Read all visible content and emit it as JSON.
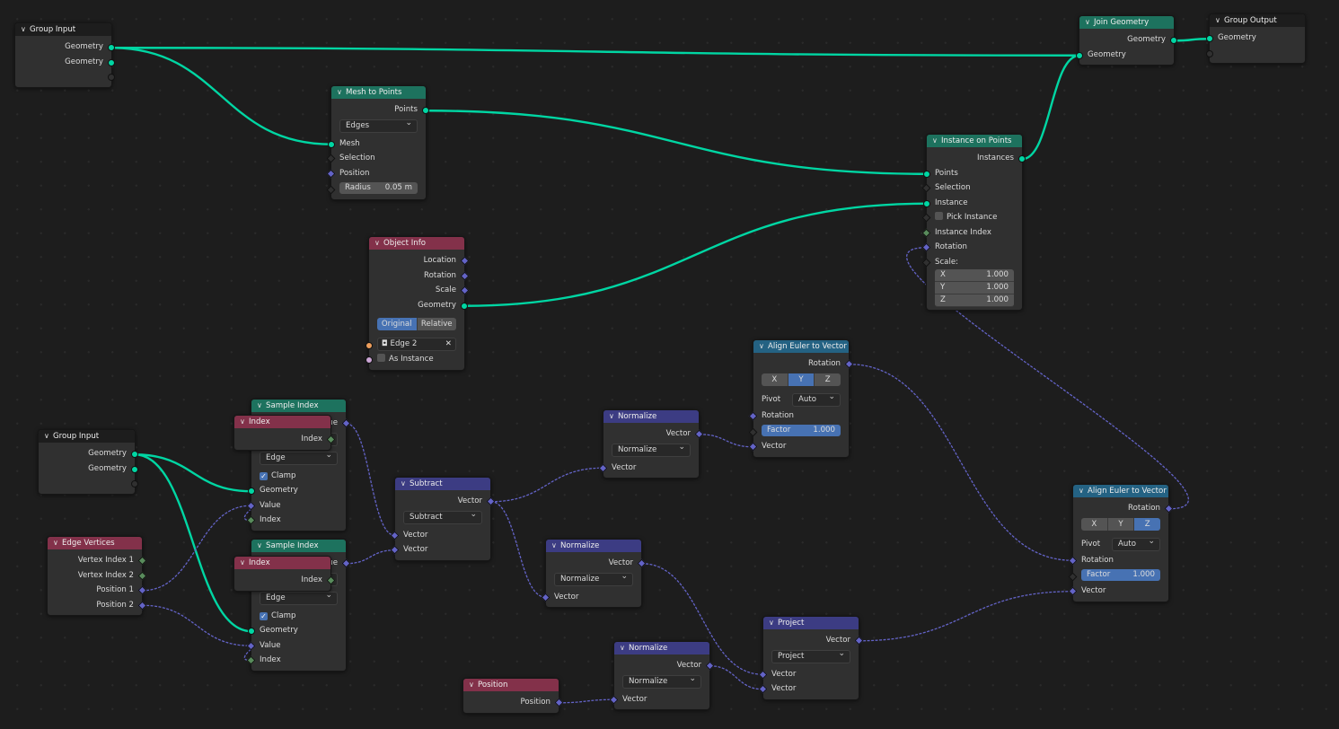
{
  "colors": {
    "background": "#1d1d1d",
    "geometry_header": "#1d725e",
    "input_header": "#83314a",
    "vector_header": "#3c3c83",
    "converter_header": "#246283",
    "group_header": "#1d1d1d",
    "geometry_link": "#00d6a3",
    "field_link": "#6363c7"
  },
  "socket_colors": {
    "geometry": "#00d6a3",
    "vector": "#6363c7",
    "bool": "#cca6d6",
    "int": "#598c5c",
    "float": "#a1a1a1",
    "object": "#ed9e5c",
    "empty": "#6b6b6b"
  },
  "nodes": [
    {
      "id": "group-input-1",
      "title": "Group Input",
      "kind": "group",
      "rows": [
        {
          "t": "out",
          "label": "Geometry",
          "s": "geometry",
          "sh": "circle"
        },
        {
          "t": "out",
          "label": "Geometry",
          "s": "geometry",
          "sh": "circle"
        },
        {
          "t": "out",
          "label": "",
          "s": "empty",
          "sh": "circle hollow"
        }
      ]
    },
    {
      "id": "mesh-to-points",
      "title": "Mesh to Points",
      "kind": "geometry",
      "rows": [
        {
          "t": "out",
          "label": "Points",
          "s": "geometry",
          "sh": "circle"
        },
        {
          "t": "dd",
          "value": "Edges"
        },
        {
          "t": "in",
          "label": "Mesh",
          "s": "geometry",
          "sh": "circle"
        },
        {
          "t": "in",
          "label": "Selection",
          "s": "bool",
          "sh": "diamond hollow"
        },
        {
          "t": "in",
          "label": "Position",
          "s": "vector",
          "sh": "diamond"
        },
        {
          "t": "field",
          "label": "Radius",
          "value": "0.05 m",
          "s": "float",
          "sh": "diamond hollow"
        }
      ]
    },
    {
      "id": "join-geometry",
      "title": "Join Geometry",
      "kind": "geometry",
      "rows": [
        {
          "t": "out",
          "label": "Geometry",
          "s": "geometry",
          "sh": "circle"
        },
        {
          "t": "in",
          "label": "Geometry",
          "s": "geometry",
          "sh": "circle"
        }
      ]
    },
    {
      "id": "group-output",
      "title": "Group Output",
      "kind": "group",
      "rows": [
        {
          "t": "in",
          "label": "Geometry",
          "s": "geometry",
          "sh": "circle"
        },
        {
          "t": "in",
          "label": "",
          "s": "empty",
          "sh": "circle hollow"
        }
      ]
    },
    {
      "id": "instance-on-points",
      "title": "Instance on Points",
      "kind": "geometry",
      "rows": [
        {
          "t": "out",
          "label": "Instances",
          "s": "geometry",
          "sh": "circle"
        },
        {
          "t": "in",
          "label": "Points",
          "s": "geometry",
          "sh": "circle"
        },
        {
          "t": "in",
          "label": "Selection",
          "s": "bool",
          "sh": "diamond hollow"
        },
        {
          "t": "in",
          "label": "Instance",
          "s": "geometry",
          "sh": "circle"
        },
        {
          "t": "check",
          "label": "Pick Instance",
          "checked": false,
          "s": "bool",
          "sh": "diamond hollow"
        },
        {
          "t": "in",
          "label": "Instance Index",
          "s": "int",
          "sh": "diamond"
        },
        {
          "t": "in",
          "label": "Rotation",
          "s": "vector",
          "sh": "diamond"
        },
        {
          "t": "in",
          "label": "Scale:",
          "s": "vector",
          "sh": "diamond hollow"
        },
        {
          "t": "xyz",
          "values": [
            [
              "X",
              "1.000"
            ],
            [
              "Y",
              "1.000"
            ],
            [
              "Z",
              "1.000"
            ]
          ]
        }
      ]
    },
    {
      "id": "object-info",
      "title": "Object Info",
      "kind": "input",
      "rows": [
        {
          "t": "out",
          "label": "Location",
          "s": "vector",
          "sh": "diamond"
        },
        {
          "t": "out",
          "label": "Rotation",
          "s": "vector",
          "sh": "diamond"
        },
        {
          "t": "out",
          "label": "Scale",
          "s": "vector",
          "sh": "diamond"
        },
        {
          "t": "out",
          "label": "Geometry",
          "s": "geometry",
          "sh": "circle"
        },
        {
          "t": "gap"
        },
        {
          "t": "seg",
          "options": [
            "Original",
            "Relative"
          ],
          "active": 0
        },
        {
          "t": "obj",
          "value": "Edge 2",
          "s": "object",
          "sh": "circle"
        },
        {
          "t": "check",
          "label": "As Instance",
          "checked": false,
          "s": "bool",
          "sh": "circle"
        }
      ]
    },
    {
      "id": "align-euler-1",
      "title": "Align Euler to Vector",
      "kind": "converter",
      "rows": [
        {
          "t": "out",
          "label": "Rotation",
          "s": "vector",
          "sh": "diamond"
        },
        {
          "t": "seg",
          "options": [
            "X",
            "Y",
            "Z"
          ],
          "active": 1
        },
        {
          "t": "pivot",
          "label": "Pivot",
          "value": "Auto"
        },
        {
          "t": "in",
          "label": "Rotation",
          "s": "vector",
          "sh": "diamond"
        },
        {
          "t": "field",
          "label": "Factor",
          "value": "1.000",
          "blue": true,
          "s": "float",
          "sh": "diamond hollow"
        },
        {
          "t": "in",
          "label": "Vector",
          "s": "vector",
          "sh": "diamond"
        }
      ]
    },
    {
      "id": "normalize-1",
      "title": "Normalize",
      "kind": "vector",
      "rows": [
        {
          "t": "out",
          "label": "Vector",
          "s": "vector",
          "sh": "diamond"
        },
        {
          "t": "dd",
          "value": "Normalize"
        },
        {
          "t": "in",
          "label": "Vector",
          "s": "vector",
          "sh": "diamond"
        }
      ]
    },
    {
      "id": "subtract",
      "title": "Subtract",
      "kind": "vector",
      "rows": [
        {
          "t": "out",
          "label": "Vector",
          "s": "vector",
          "sh": "diamond"
        },
        {
          "t": "dd",
          "value": "Subtract"
        },
        {
          "t": "in",
          "label": "Vector",
          "s": "vector",
          "sh": "diamond"
        },
        {
          "t": "in",
          "label": "Vector",
          "s": "vector",
          "sh": "diamond"
        }
      ]
    },
    {
      "id": "sample-index-1",
      "title": "Sample Index",
      "kind": "geometry",
      "rows": [
        {
          "t": "out",
          "label": "Value",
          "s": "vector",
          "sh": "diamond"
        },
        {
          "t": "dd",
          "value": ""
        },
        {
          "t": "dd",
          "value": "Edge"
        },
        {
          "t": "check",
          "label": "Clamp",
          "checked": true
        },
        {
          "t": "in",
          "label": "Geometry",
          "s": "geometry",
          "sh": "circle"
        },
        {
          "t": "in",
          "label": "Value",
          "s": "vector",
          "sh": "diamond"
        },
        {
          "t": "in",
          "label": "Index",
          "s": "int",
          "sh": "diamond"
        }
      ]
    },
    {
      "id": "index-1",
      "title": "Index",
      "kind": "input",
      "rows": [
        {
          "t": "out",
          "label": "Index",
          "s": "int",
          "sh": "diamond"
        }
      ]
    },
    {
      "id": "sample-index-2",
      "title": "Sample Index",
      "kind": "geometry",
      "rows": [
        {
          "t": "out",
          "label": "Value",
          "s": "vector",
          "sh": "diamond"
        },
        {
          "t": "dd",
          "value": ""
        },
        {
          "t": "dd",
          "value": "Edge"
        },
        {
          "t": "check",
          "label": "Clamp",
          "checked": true
        },
        {
          "t": "in",
          "label": "Geometry",
          "s": "geometry",
          "sh": "circle"
        },
        {
          "t": "in",
          "label": "Value",
          "s": "vector",
          "sh": "diamond"
        },
        {
          "t": "in",
          "label": "Index",
          "s": "int",
          "sh": "diamond"
        }
      ]
    },
    {
      "id": "index-2",
      "title": "Index",
      "kind": "input",
      "rows": [
        {
          "t": "out",
          "label": "Index",
          "s": "int",
          "sh": "diamond"
        }
      ]
    },
    {
      "id": "group-input-2",
      "title": "Group Input",
      "kind": "group",
      "rows": [
        {
          "t": "out",
          "label": "Geometry",
          "s": "geometry",
          "sh": "circle"
        },
        {
          "t": "out",
          "label": "Geometry",
          "s": "geometry",
          "sh": "circle"
        },
        {
          "t": "out",
          "label": "",
          "s": "empty",
          "sh": "circle hollow"
        }
      ]
    },
    {
      "id": "edge-vertices",
      "title": "Edge Vertices",
      "kind": "input",
      "rows": [
        {
          "t": "out",
          "label": "Vertex Index 1",
          "s": "int",
          "sh": "diamond"
        },
        {
          "t": "out",
          "label": "Vertex Index 2",
          "s": "int",
          "sh": "diamond"
        },
        {
          "t": "out",
          "label": "Position 1",
          "s": "vector",
          "sh": "diamond"
        },
        {
          "t": "out",
          "label": "Position 2",
          "s": "vector",
          "sh": "diamond"
        }
      ]
    },
    {
      "id": "normalize-2",
      "title": "Normalize",
      "kind": "vector",
      "rows": [
        {
          "t": "out",
          "label": "Vector",
          "s": "vector",
          "sh": "diamond"
        },
        {
          "t": "dd",
          "value": "Normalize"
        },
        {
          "t": "in",
          "label": "Vector",
          "s": "vector",
          "sh": "diamond"
        }
      ]
    },
    {
      "id": "normalize-3",
      "title": "Normalize",
      "kind": "vector",
      "rows": [
        {
          "t": "out",
          "label": "Vector",
          "s": "vector",
          "sh": "diamond"
        },
        {
          "t": "dd",
          "value": "Normalize"
        },
        {
          "t": "in",
          "label": "Vector",
          "s": "vector",
          "sh": "diamond"
        }
      ]
    },
    {
      "id": "position",
      "title": "Position",
      "kind": "input",
      "rows": [
        {
          "t": "out",
          "label": "Position",
          "s": "vector",
          "sh": "diamond"
        }
      ]
    },
    {
      "id": "project",
      "title": "Project",
      "kind": "vector",
      "rows": [
        {
          "t": "out",
          "label": "Vector",
          "s": "vector",
          "sh": "diamond"
        },
        {
          "t": "dd",
          "value": "Project"
        },
        {
          "t": "in",
          "label": "Vector",
          "s": "vector",
          "sh": "diamond"
        },
        {
          "t": "in",
          "label": "Vector",
          "s": "vector",
          "sh": "diamond"
        }
      ]
    },
    {
      "id": "align-euler-2",
      "title": "Align Euler to Vector",
      "kind": "converter",
      "rows": [
        {
          "t": "out",
          "label": "Rotation",
          "s": "vector",
          "sh": "diamond"
        },
        {
          "t": "seg",
          "options": [
            "X",
            "Y",
            "Z"
          ],
          "active": 2
        },
        {
          "t": "pivot",
          "label": "Pivot",
          "value": "Auto"
        },
        {
          "t": "in",
          "label": "Rotation",
          "s": "vector",
          "sh": "diamond"
        },
        {
          "t": "field",
          "label": "Factor",
          "value": "1.000",
          "blue": true,
          "s": "float",
          "sh": "diamond hollow"
        },
        {
          "t": "in",
          "label": "Vector",
          "s": "vector",
          "sh": "diamond"
        }
      ]
    }
  ],
  "links": [
    [
      "group-input-1",
      0,
      "join-geometry",
      1,
      "geometry"
    ],
    [
      "group-input-1",
      0,
      "mesh-to-points",
      2,
      "geometry"
    ],
    [
      "mesh-to-points",
      0,
      "instance-on-points",
      1,
      "geometry"
    ],
    [
      "object-info",
      3,
      "instance-on-points",
      3,
      "geometry"
    ],
    [
      "instance-on-points",
      0,
      "join-geometry",
      1,
      "geometry"
    ],
    [
      "join-geometry",
      0,
      "group-output",
      0,
      "geometry"
    ],
    [
      "group-input-2",
      0,
      "sample-index-1",
      4,
      "geometry"
    ],
    [
      "group-input-2",
      0,
      "sample-index-2",
      4,
      "geometry"
    ],
    [
      "edge-vertices",
      2,
      "sample-index-1",
      5,
      "field"
    ],
    [
      "edge-vertices",
      3,
      "sample-index-2",
      5,
      "field"
    ],
    [
      "index-1",
      0,
      "sample-index-1",
      6,
      "field"
    ],
    [
      "index-2",
      0,
      "sample-index-2",
      6,
      "field"
    ],
    [
      "sample-index-1",
      0,
      "subtract",
      2,
      "field"
    ],
    [
      "sample-index-2",
      0,
      "subtract",
      3,
      "field"
    ],
    [
      "subtract",
      0,
      "normalize-1",
      2,
      "field"
    ],
    [
      "subtract",
      0,
      "normalize-2",
      2,
      "field"
    ],
    [
      "normalize-1",
      0,
      "align-euler-1",
      5,
      "field"
    ],
    [
      "align-euler-1",
      0,
      "align-euler-2",
      3,
      "field"
    ],
    [
      "align-euler-2",
      0,
      "instance-on-points",
      6,
      "field"
    ],
    [
      "normalize-2",
      0,
      "project",
      2,
      "field"
    ],
    [
      "normalize-3",
      0,
      "project",
      3,
      "field"
    ],
    [
      "position",
      0,
      "normalize-3",
      2,
      "field"
    ],
    [
      "project",
      0,
      "align-euler-2",
      5,
      "field"
    ]
  ]
}
